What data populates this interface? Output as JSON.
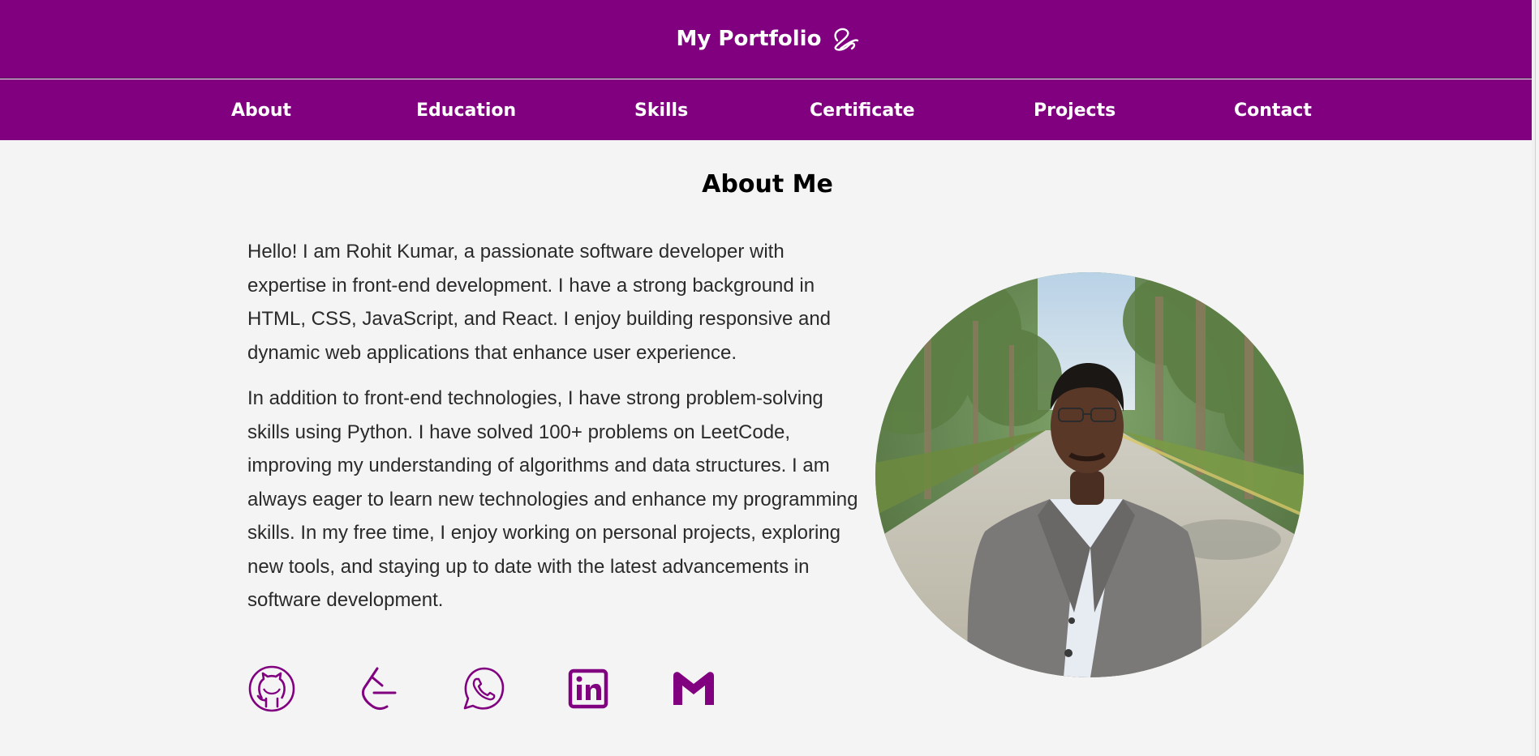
{
  "header": {
    "title": "My Portfolio",
    "icon": "signature-icon"
  },
  "nav": {
    "items": [
      {
        "label": "About"
      },
      {
        "label": "Education"
      },
      {
        "label": "Skills"
      },
      {
        "label": "Certificate"
      },
      {
        "label": "Projects"
      },
      {
        "label": "Contact"
      }
    ]
  },
  "about": {
    "heading": "About Me",
    "paragraphs": [
      "Hello! I am Rohit Kumar, a passionate software developer with expertise in front-end development. I have a strong background in HTML, CSS, JavaScript, and React. I enjoy building responsive and dynamic web applications that enhance user experience.",
      "In addition to front-end technologies, I have strong problem-solving skills using Python. I have solved 100+ problems on LeetCode, improving my understanding of algorithms and data structures. I am always eager to learn new technologies and enhance my programming skills. In my free time, I enjoy working on personal projects, exploring new tools, and staying up to date with the latest advancements in software development."
    ],
    "photo": "profile-photo",
    "socials": [
      {
        "icon": "github-icon"
      },
      {
        "icon": "leetcode-icon"
      },
      {
        "icon": "whatsapp-icon"
      },
      {
        "icon": "linkedin-icon"
      },
      {
        "icon": "gmail-icon"
      }
    ]
  },
  "colors": {
    "brand": "#800080",
    "background": "#f4f4f4",
    "text": "#2a2a2a"
  }
}
